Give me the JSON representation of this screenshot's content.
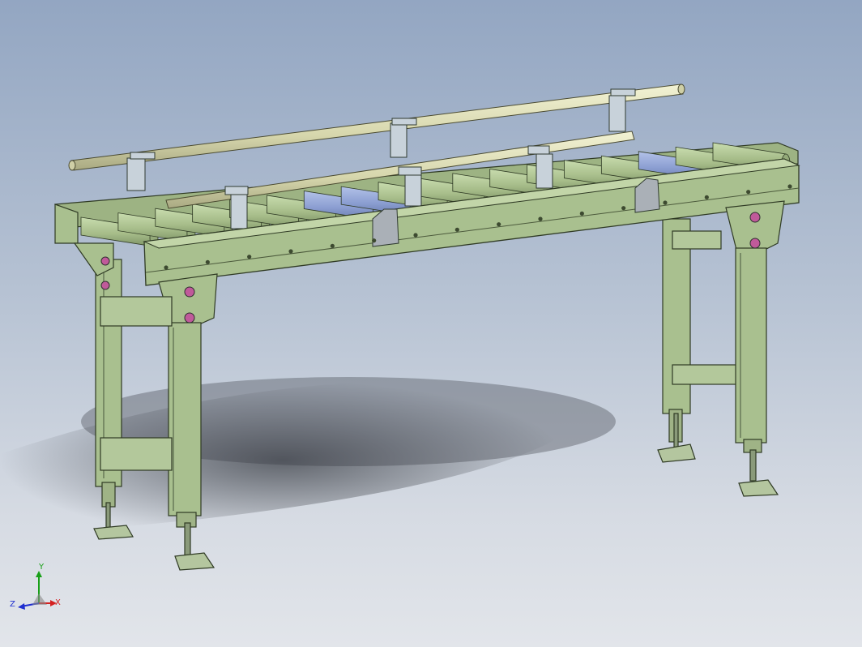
{
  "viewport": {
    "background_top": "#93a6c2",
    "background_bottom": "#e2e5ea"
  },
  "model": {
    "subject": "roller-conveyor-stand",
    "frame_color": "#a9c08f",
    "frame_edge": "#2f3a24",
    "roller_color": "#a7bd8a",
    "drive_roller_color": "#8c9fd2",
    "rail_color": "#dcdcb6",
    "bracket_color": "#c8d2da",
    "end_cap_color": "#aab0b7",
    "bolt_color": "#c05a9a",
    "roller_count": 18,
    "drive_roller_count": 3
  },
  "triad": {
    "x_label": "X",
    "y_label": "Y",
    "z_label": "Z",
    "x_color": "#d42020",
    "y_color": "#18a018",
    "z_color": "#2030d0"
  }
}
